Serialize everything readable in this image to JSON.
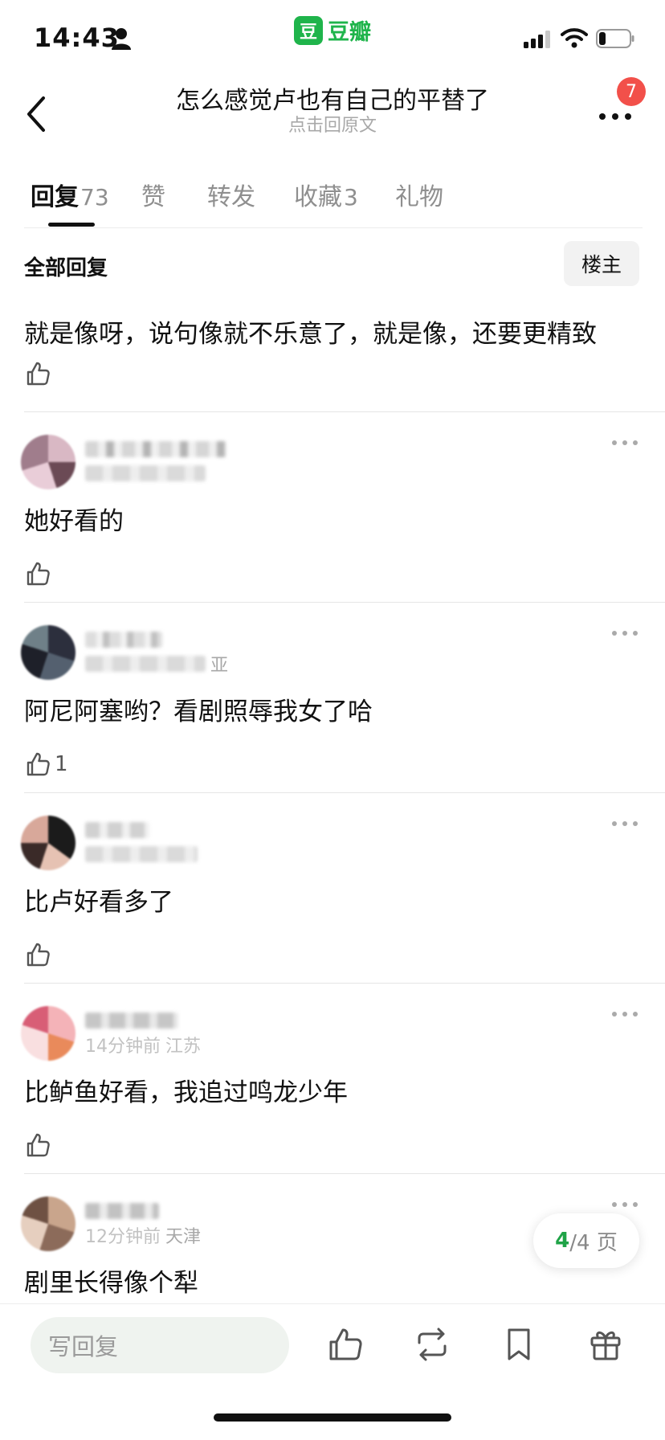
{
  "status_bar": {
    "time": "14:43"
  },
  "app": {
    "name": "豆瓣",
    "logo_char": "豆",
    "brand_color": "#1fb44b"
  },
  "nav": {
    "title": "怎么感觉卢也有自己的平替了",
    "subtitle": "点击回原文",
    "badge_count": "7"
  },
  "tabs": [
    {
      "label": "回复",
      "count": "73",
      "active": true
    },
    {
      "label": "赞",
      "count": ""
    },
    {
      "label": "转发",
      "count": ""
    },
    {
      "label": "收藏",
      "count": "3"
    },
    {
      "label": "礼物",
      "count": ""
    }
  ],
  "filter": {
    "title": "全部回复",
    "op_button": "楼主"
  },
  "first_comment": {
    "text": "就是像呀，说句像就不乐意了，就是像，还要更精致",
    "likes": ""
  },
  "comments": [
    {
      "text": "她好看的",
      "likes": "",
      "time": "",
      "location": ""
    },
    {
      "text": "阿尼阿塞哟？看剧照辱我女了哈",
      "likes": "1",
      "time": "",
      "location": "亚"
    },
    {
      "text": "比卢好看多了",
      "likes": "",
      "time": "",
      "location": ""
    },
    {
      "text": "比鲈鱼好看，我追过鸣龙少年",
      "likes": "",
      "time": "14分钟前",
      "location": "江苏"
    },
    {
      "text": "剧里长得像个犁",
      "likes": "",
      "time": "12分钟前",
      "location": "天津"
    }
  ],
  "pagination": {
    "current": "4",
    "total": "/4 页"
  },
  "bottom_bar": {
    "reply_placeholder": "写回复"
  },
  "icons": [
    "back-icon",
    "more-icon",
    "thumb-up-icon",
    "repost-icon",
    "bookmark-icon",
    "gift-icon"
  ]
}
